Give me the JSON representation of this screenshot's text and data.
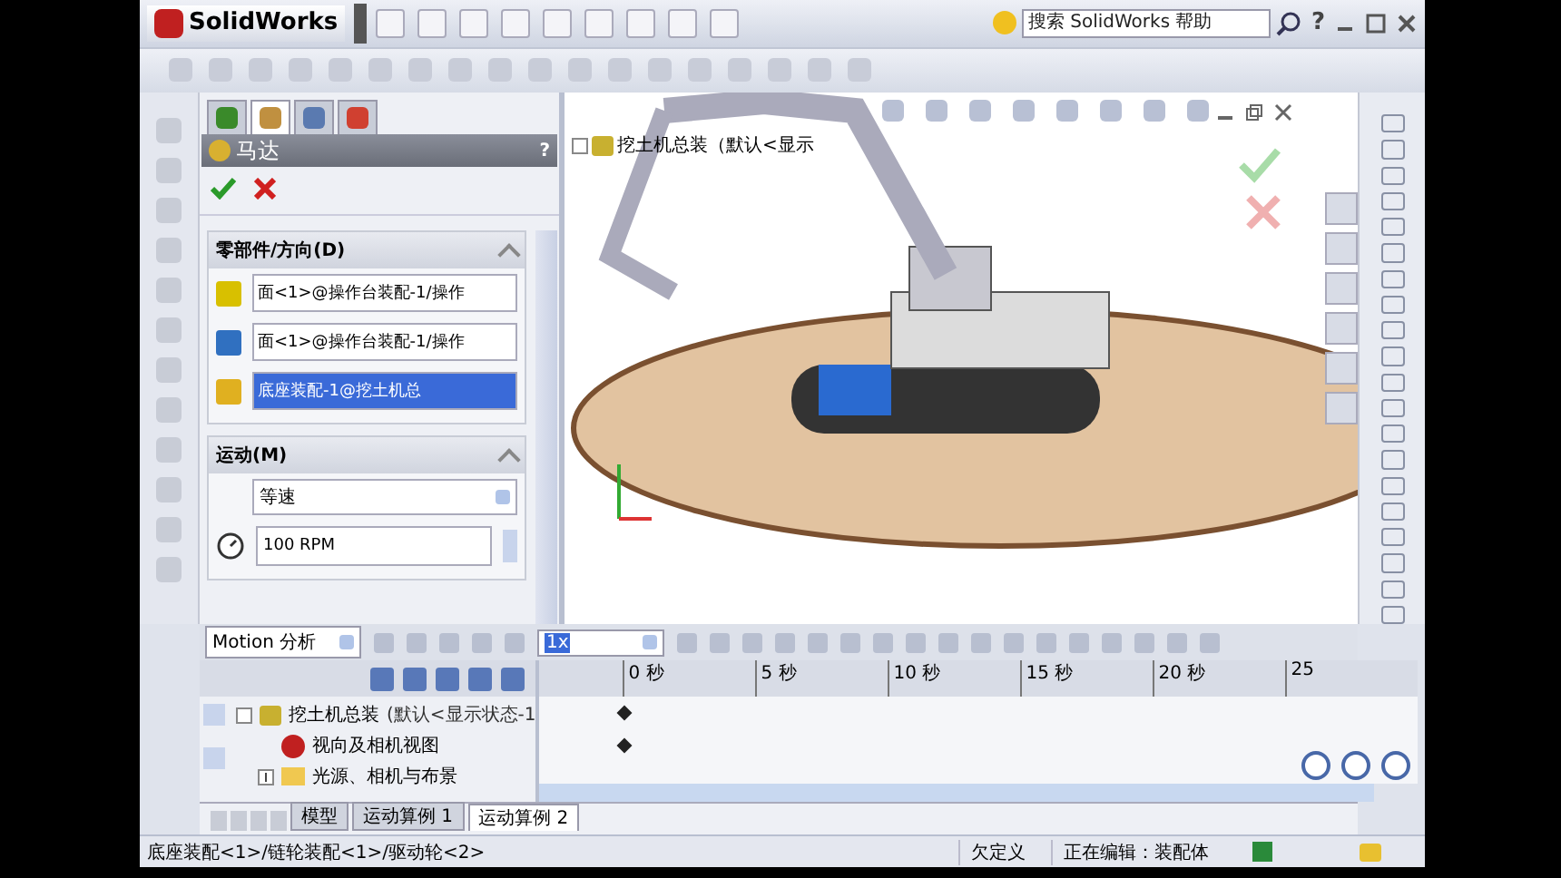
{
  "app": {
    "logo": "SolidWorks",
    "search": {
      "placeholder": "搜索 SolidWorks 帮助"
    },
    "help": "?"
  },
  "panel_tabs": [
    {
      "selected": false
    },
    {
      "selected": true
    },
    {
      "selected": false
    },
    {
      "selected": false
    }
  ],
  "property_manager": {
    "title": "马达",
    "help": "?",
    "components_section": {
      "title": "零部件/方向(D)",
      "fields": [
        {
          "kind": "face",
          "value": "面<1>@操作台装配-1/操作",
          "selected": false
        },
        {
          "kind": "direction",
          "value": "面<1>@操作台装配-1/操作",
          "selected": false
        },
        {
          "kind": "part",
          "value": "底座装配-1@挖土机总",
          "selected": true
        }
      ]
    },
    "motion_section": {
      "title": "运动(M)",
      "type": "等速",
      "speed": "100 RPM"
    }
  },
  "viewport": {
    "tree_label": "挖土机总装（默认<显示"
  },
  "motion": {
    "study_type": "Motion 分析",
    "playback_speed": "1x",
    "tree": [
      {
        "label": "挖土机总装",
        "config": "(默认<显示状态-1",
        "expanded": true,
        "children": [
          {
            "label": "视向及相机视图"
          },
          {
            "label": "光源、相机与布景",
            "expanded": false
          }
        ]
      }
    ],
    "timeline_ticks": [
      "0 秒",
      "5 秒",
      "10 秒",
      "15 秒",
      "20 秒",
      "25"
    ]
  },
  "study_tabs": [
    {
      "label": "模型",
      "selected": false
    },
    {
      "label": "运动算例 1",
      "selected": false
    },
    {
      "label": "运动算例 2",
      "selected": true
    }
  ],
  "status_bar": {
    "path": "底座装配<1>/链轮装配<1>/驱动轮<2>",
    "state": "欠定义",
    "editing": "正在编辑：装配体"
  }
}
